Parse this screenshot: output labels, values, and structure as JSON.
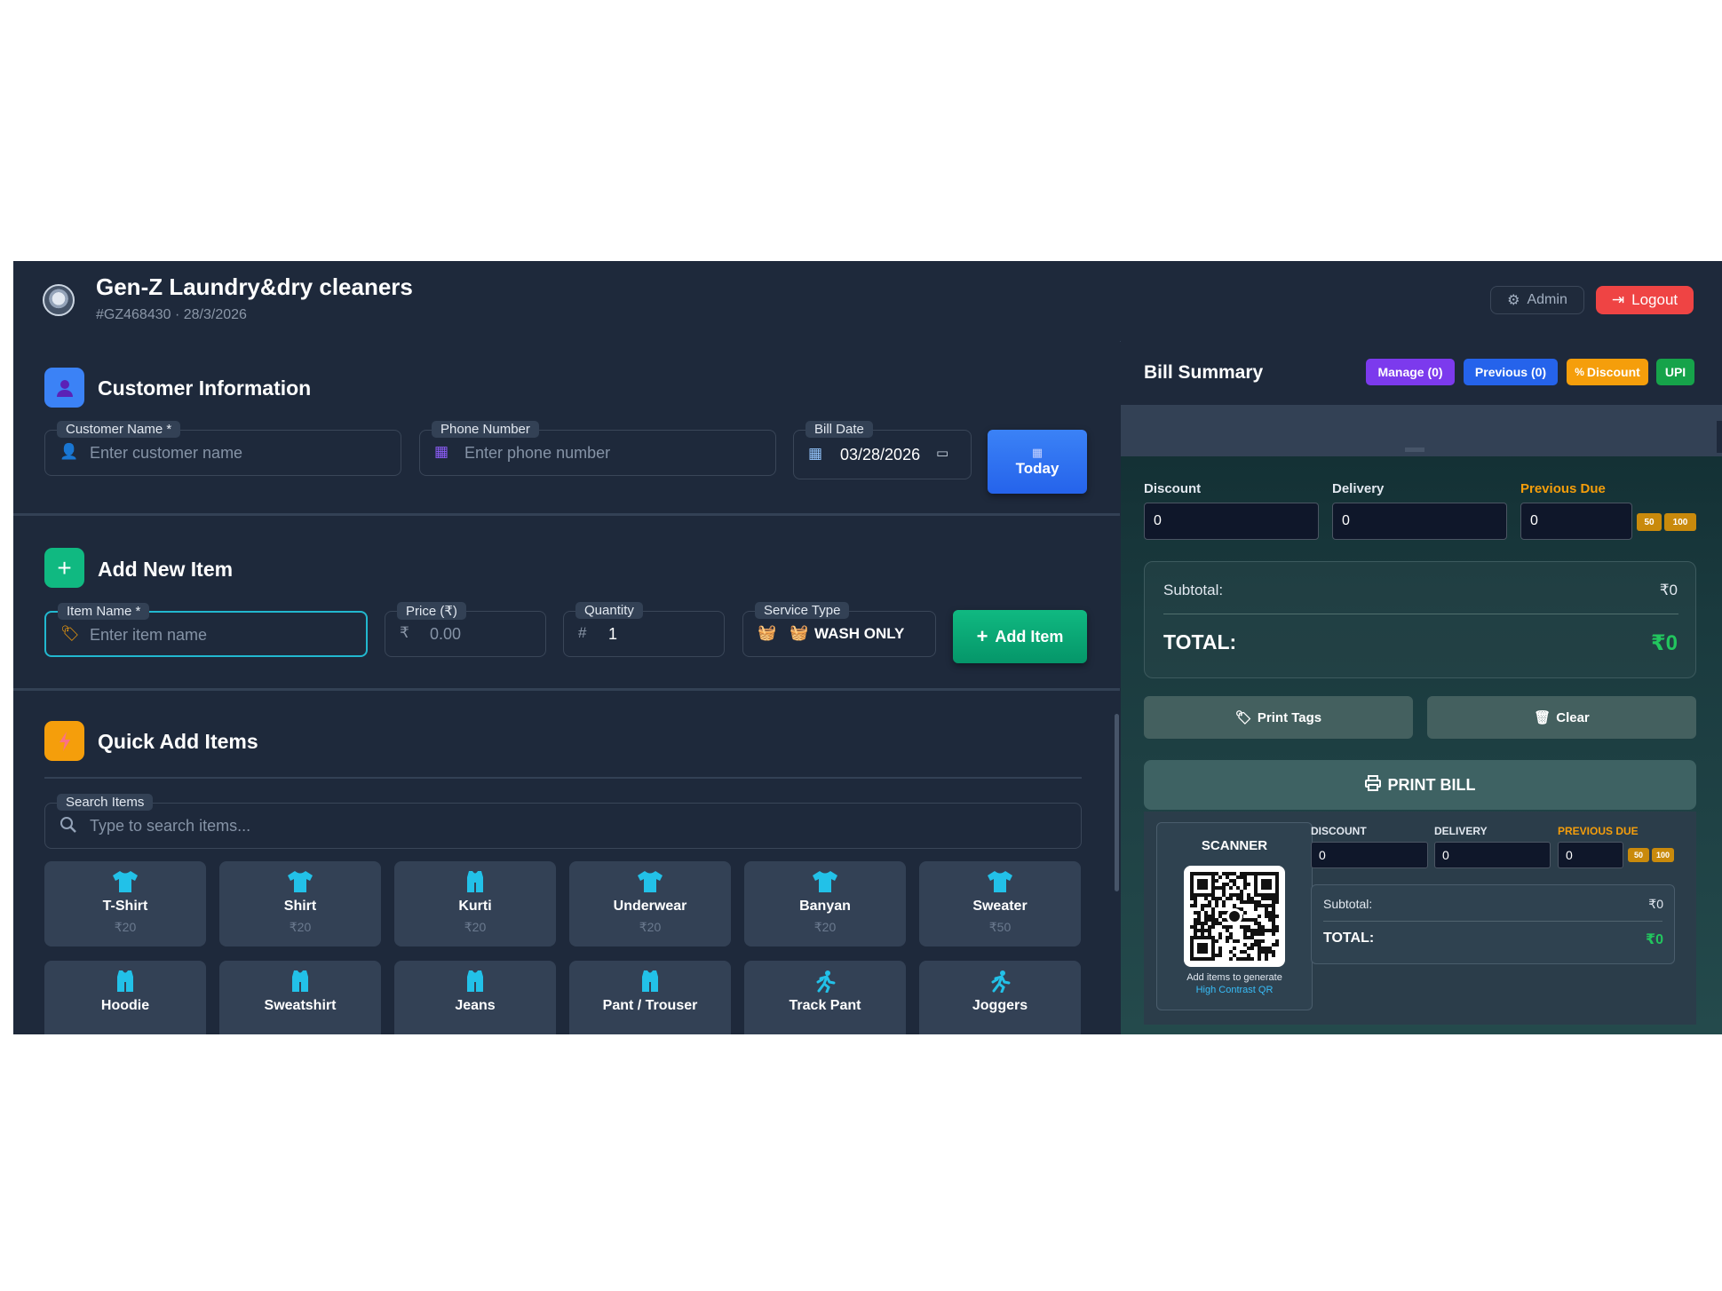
{
  "header": {
    "title": "Gen-Z Laundry&dry cleaners",
    "subtitle": "#GZ468430 · 28/3/2026",
    "admin_label": "Admin",
    "logout_label": "Logout"
  },
  "customer": {
    "section_title": "Customer Information",
    "name_label": "Customer Name *",
    "name_placeholder": "Enter customer name",
    "phone_label": "Phone Number",
    "phone_placeholder": "Enter phone number",
    "date_label": "Bill Date",
    "date_value": "03/28/2026",
    "today_label": "Today"
  },
  "add_item": {
    "section_title": "Add New Item",
    "item_label": "Item Name *",
    "item_placeholder": "Enter item name",
    "price_label": "Price (₹)",
    "price_symbol": "₹",
    "price_placeholder": "0.00",
    "qty_label": "Quantity",
    "qty_symbol": "#",
    "qty_value": "1",
    "service_label": "Service Type",
    "service_value": "WASH ONLY",
    "add_label": "Add Item"
  },
  "quick_add": {
    "section_title": "Quick Add Items",
    "search_label": "Search Items",
    "search_placeholder": "Type to search items...",
    "items": [
      {
        "name": "T-Shirt",
        "price": "₹20",
        "icon": "tshirt-icon"
      },
      {
        "name": "Shirt",
        "price": "₹20",
        "icon": "tshirt-icon"
      },
      {
        "name": "Kurti",
        "price": "₹20",
        "icon": "vest-icon"
      },
      {
        "name": "Underwear",
        "price": "₹20",
        "icon": "tshirt-icon"
      },
      {
        "name": "Banyan",
        "price": "₹20",
        "icon": "tshirt-icon"
      },
      {
        "name": "Sweater",
        "price": "₹50",
        "icon": "tshirt-icon"
      },
      {
        "name": "Hoodie",
        "price": "",
        "icon": "vest-icon"
      },
      {
        "name": "Sweatshirt",
        "price": "",
        "icon": "vest-icon"
      },
      {
        "name": "Jeans",
        "price": "",
        "icon": "vest-icon"
      },
      {
        "name": "Pant / Trouser",
        "price": "",
        "icon": "vest-icon"
      },
      {
        "name": "Track Pant",
        "price": "",
        "icon": "running-icon"
      },
      {
        "name": "Joggers",
        "price": "",
        "icon": "running-icon"
      }
    ]
  },
  "bill": {
    "title": "Bill Summary",
    "manage_label": "Manage (0)",
    "previous_label": "Previous (0)",
    "discount_btn_label": "Discount",
    "upi_label": "UPI",
    "discount_label": "Discount",
    "discount_value": "0",
    "delivery_label": "Delivery",
    "delivery_value": "0",
    "prev_due_label": "Previous Due",
    "prev_due_value": "0",
    "quick_50": "50",
    "quick_100": "100",
    "subtotal_label": "Subtotal:",
    "subtotal_value": "₹0",
    "total_label": "TOTAL:",
    "total_value": "₹0",
    "print_tags_label": "Print Tags",
    "clear_label": "Clear",
    "print_bill_label": "PRINT BILL"
  },
  "preview": {
    "scanner_title": "SCANNER",
    "scanner_note": "Add items to generate",
    "scanner_link": "High Contrast QR",
    "discount_label": "DISCOUNT",
    "discount_value": "0",
    "delivery_label": "DELIVERY",
    "delivery_value": "0",
    "prev_due_label": "PREVIOUS DUE",
    "prev_due_value": "0",
    "quick_50": "50",
    "quick_100": "100",
    "subtotal_label": "Subtotal:",
    "subtotal_value": "₹0",
    "total_label": "TOTAL:",
    "total_value": "₹0"
  },
  "colors": {
    "bg": "#1e293b",
    "accent_blue": "#3b82f6",
    "accent_green": "#10b981",
    "accent_orange": "#f59e0b",
    "danger": "#ef4444",
    "icon_cyan": "#22c1e8"
  }
}
